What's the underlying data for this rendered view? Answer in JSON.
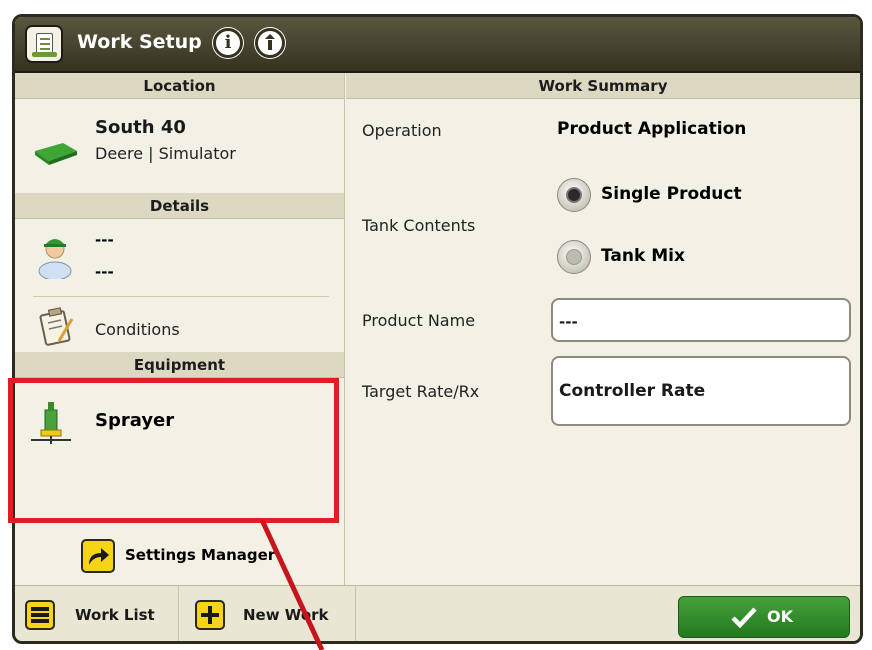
{
  "title": "Work Setup",
  "left_panel": {
    "location": {
      "header": "Location",
      "name": "South 40",
      "subtitle": "Deere | Simulator"
    },
    "details": {
      "header": "Details",
      "operator_line1": "---",
      "operator_line2": "---",
      "conditions_label": "Conditions"
    },
    "equipment": {
      "header": "Equipment",
      "name": "Sprayer"
    },
    "settings_manager_label": "Settings Manager"
  },
  "work_summary": {
    "header": "Work Summary",
    "operation_label": "Operation",
    "operation_value": "Product Application",
    "tank_contents_label": "Tank Contents",
    "tank_options": [
      {
        "label": "Single Product",
        "selected": true
      },
      {
        "label": "Tank Mix",
        "selected": false
      }
    ],
    "product_name_label": "Product Name",
    "product_name_value": "---",
    "target_rate_label": "Target Rate/Rx",
    "target_rate_value": "Controller Rate"
  },
  "footer": {
    "work_list_label": "Work List",
    "new_work_label": "New Work",
    "ok_label": "OK"
  },
  "colors": {
    "titlebar": "#35321f",
    "accent_yellow": "#f7d417",
    "ok_green": "#2e8b27",
    "highlight_red": "#e51c23"
  }
}
